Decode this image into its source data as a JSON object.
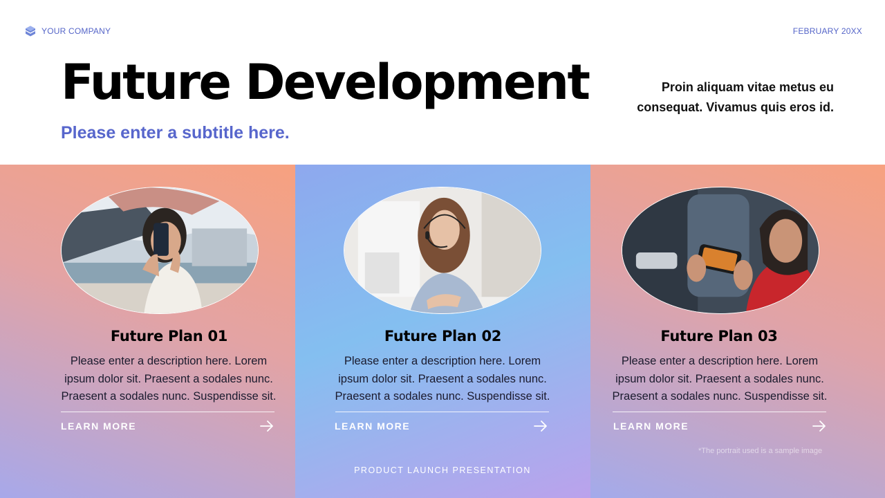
{
  "header": {
    "company": "YOUR COMPANY",
    "date": "FEBRUARY 20XX",
    "title": "Future Development",
    "subtitle": "Please enter a subtitle here.",
    "intro": "Proin aliquam vitae metus eu consequat. Vivamus quis eros id."
  },
  "plans": [
    {
      "title": "Future Plan 01",
      "description": "Please enter a description here. Lorem ipsum dolor sit. Praesent a sodales nunc. Praesent a sodales nunc. Suspendisse sit.",
      "link": "LEARN MORE",
      "photo_icon": "woman-phone-photo"
    },
    {
      "title": "Future Plan 02",
      "description": "Please enter a description here. Lorem ipsum dolor sit. Praesent a sodales nunc. Praesent a sodales nunc. Suspendisse sit.",
      "link": "LEARN MORE",
      "photo_icon": "woman-headset-photo"
    },
    {
      "title": "Future Plan 03",
      "description": "Please enter a description here. Lorem ipsum dolor sit. Praesent a sodales nunc. Praesent a sodales nunc. Suspendisse sit.",
      "link": "LEARN MORE",
      "photo_icon": "man-gaming-photo"
    }
  ],
  "note": "*The portrait used is a sample image",
  "footer": "PRODUCT LAUNCH PRESENTATION",
  "colors": {
    "accent": "#5766cc",
    "peach": "#f7a17f",
    "sky": "#84bff0",
    "lavender": "#a7a8ea"
  }
}
